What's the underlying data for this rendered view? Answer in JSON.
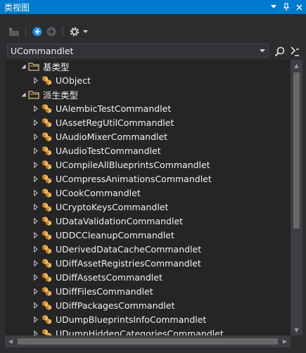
{
  "window": {
    "title": "类视图",
    "dropdown_icon": "chevron-down-icon",
    "pin_icon": "pin-icon",
    "close_icon": "close-icon"
  },
  "toolbar": {
    "new_folder_icon": "new-folder-icon",
    "back_icon": "back-arrow-icon",
    "forward_icon": "forward-arrow-icon",
    "settings_icon": "gear-icon"
  },
  "search": {
    "value": "UCommandlet"
  },
  "tree": {
    "base_types_label": "基类型",
    "base_type_items": [
      "UObject"
    ],
    "derived_types_label": "派生类型",
    "derived_items": [
      "UAlembicTestCommandlet",
      "UAssetRegUtilCommandlet",
      "UAudioMixerCommandlet",
      "UAudioTestCommandlet",
      "UCompileAllBlueprintsCommandlet",
      "UCompressAnimationsCommandlet",
      "UCookCommandlet",
      "UCryptoKeysCommandlet",
      "UDataValidationCommandlet",
      "UDDCCleanupCommandlet",
      "UDerivedDataCacheCommandlet",
      "UDiffAssetRegistriesCommandlet",
      "UDiffAssetsCommandlet",
      "UDiffFilesCommandlet",
      "UDiffPackagesCommandlet",
      "UDumpBlueprintsInfoCommandlet",
      "UDumpHiddenCategoriesCommandlet"
    ]
  },
  "colors": {
    "accent": "#007acc",
    "background": "#2d2d30",
    "tree_background": "#252526",
    "class_icon": "#e8a33d",
    "folder_icon": "#dcb67a"
  }
}
